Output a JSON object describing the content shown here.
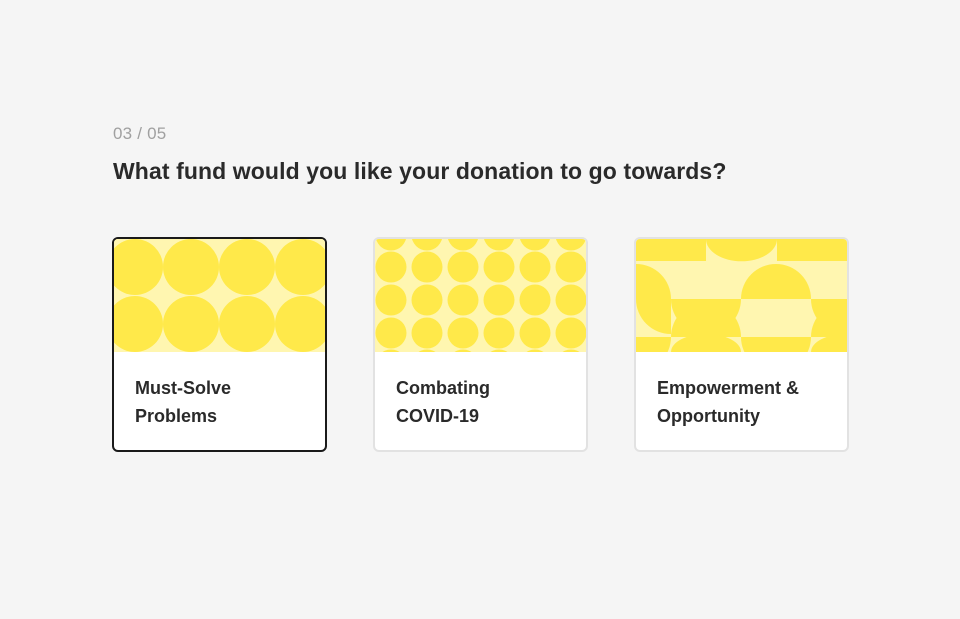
{
  "progress": {
    "text": "03 / 05",
    "current": 3,
    "total": 5
  },
  "question": "What fund would you like your donation to go towards?",
  "colors": {
    "accent_yellow": "#ffe94a",
    "pale_yellow": "#fff6b0",
    "selected_border": "#1a1a1a"
  },
  "options": [
    {
      "label": "Must-Solve\nProblems",
      "pattern": "large-circles",
      "selected": true
    },
    {
      "label": "Combating\nCOVID-19",
      "pattern": "small-circles",
      "selected": false
    },
    {
      "label": "Empowerment &\nOpportunity",
      "pattern": "half-circles",
      "selected": false
    }
  ]
}
